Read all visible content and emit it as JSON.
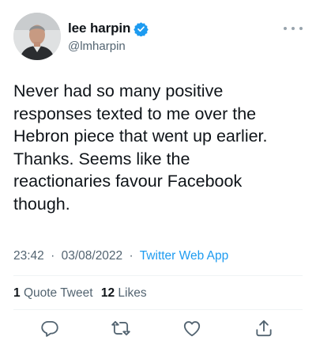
{
  "author": {
    "display_name": "lee harpin",
    "handle": "@lmharpin",
    "verified": true
  },
  "tweet": {
    "text": "Never had so many positive\nresponses texted to me over the\nHebron piece that went up earlier.\nThanks. Seems like the\nreactionaries favour Facebook\nthough.",
    "time": "23:42",
    "date": "03/08/2022",
    "separator": "·",
    "source": "Twitter Web App"
  },
  "stats": {
    "quote_count": "1",
    "quote_label": "Quote Tweet",
    "like_count": "12",
    "like_label": "Likes"
  },
  "icons": {
    "verified": "verified-badge-icon",
    "more": "more-options-icon",
    "reply": "reply-icon",
    "retweet": "retweet-icon",
    "like": "heart-icon",
    "share": "share-icon"
  },
  "colors": {
    "accent": "#1d9bf0",
    "text": "#0f1419",
    "secondary": "#536471"
  }
}
